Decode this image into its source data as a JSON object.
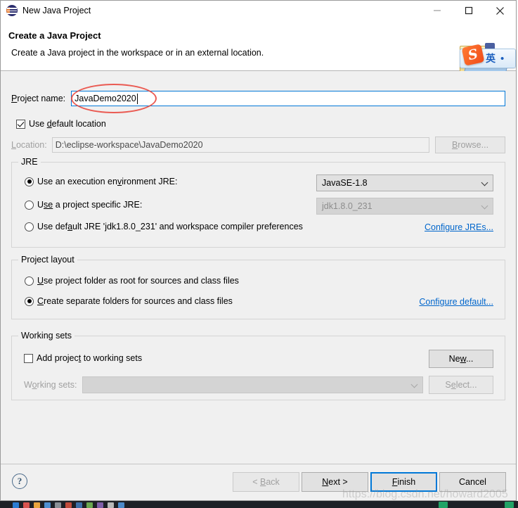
{
  "window": {
    "title": "New Java Project",
    "icon": "eclipse-java-icon",
    "minimize_label": "Minimize",
    "maximize_label": "Maximize",
    "close_label": "Close"
  },
  "header": {
    "title": "Create a Java Project",
    "description": "Create a Java project in the workspace or in an external location."
  },
  "ime": {
    "logo_letter": "S",
    "language": "英",
    "dot": "•"
  },
  "project_name": {
    "label": "Project name:",
    "label_prefix": "P",
    "label_rest": "roject name:",
    "value": "JavaDemo2020",
    "placeholder": ""
  },
  "use_default_location": {
    "label_a": "Use ",
    "label_acc": "d",
    "label_b": "efault location",
    "checked": true
  },
  "location": {
    "label": "Location:",
    "value": "D:\\eclipse-workspace\\JavaDemo2020",
    "browse_label": "Browse...",
    "browse_acc": "B",
    "browse_rest": "rowse...",
    "disabled": true
  },
  "jre": {
    "group_title": "JRE",
    "options": [
      {
        "label_a": "Use an execution en",
        "label_acc": "v",
        "label_b": "ironment JRE:",
        "selected": true,
        "combo_value": "JavaSE-1.8",
        "combo_disabled": false
      },
      {
        "label_a": "U",
        "label_acc": "se",
        "label_b": " a project specific JRE:",
        "selected": false,
        "combo_value": "jdk1.8.0_231",
        "combo_disabled": true
      },
      {
        "label_a": "Use def",
        "label_acc": "a",
        "label_b": "ult JRE 'jdk1.8.0_231' and workspace compiler preferences",
        "selected": false
      }
    ],
    "configure_link": "Configure JREs..."
  },
  "project_layout": {
    "group_title": "Project layout",
    "options": [
      {
        "label_a": "",
        "label_acc": "U",
        "label_b": "se project folder as root for sources and class files",
        "selected": false
      },
      {
        "label_a": "",
        "label_acc": "C",
        "label_b": "reate separate folders for sources and class files",
        "selected": true
      }
    ],
    "configure_link": "Configure default..."
  },
  "working_sets": {
    "group_title": "Working sets",
    "add_checkbox": {
      "label_a": "Add projec",
      "label_acc": "t",
      "label_b": " to working sets",
      "checked": false
    },
    "new_button": {
      "label_a": "Ne",
      "label_acc": "w",
      "label_b": "..."
    },
    "sets_label_a": "W",
    "sets_label_acc": "o",
    "sets_label_b": "rking sets:",
    "sets_value": "",
    "select_button": {
      "label_a": "S",
      "label_acc": "e",
      "label_b": "lect..."
    }
  },
  "footer": {
    "help_glyph": "?",
    "buttons": [
      {
        "name": "back",
        "label_a": "< ",
        "label_acc": "B",
        "label_b": "ack",
        "disabled": true,
        "default": false
      },
      {
        "name": "next",
        "label_a": "",
        "label_acc": "N",
        "label_b": "ext >",
        "disabled": false,
        "default": false
      },
      {
        "name": "finish",
        "label_a": "",
        "label_acc": "F",
        "label_b": "inish",
        "disabled": false,
        "default": true
      },
      {
        "name": "cancel",
        "label_a": "Cancel",
        "label_acc": "",
        "label_b": "",
        "disabled": false,
        "default": false
      }
    ]
  },
  "annotation": {
    "type": "red-ellipse-highlight",
    "color": "#e8453c",
    "target": "project-name-value"
  },
  "watermark": {
    "text": "https://blog.csdn.net/howard2005"
  },
  "colors": {
    "accent": "#0078d7",
    "link": "#0066cc",
    "dialog_bg": "#f0f0f0",
    "header_bg": "#ffffff",
    "annotation_red": "#e8453c",
    "sogou_orange": "#f04b18",
    "ime_blue": "#1b5fbe"
  }
}
